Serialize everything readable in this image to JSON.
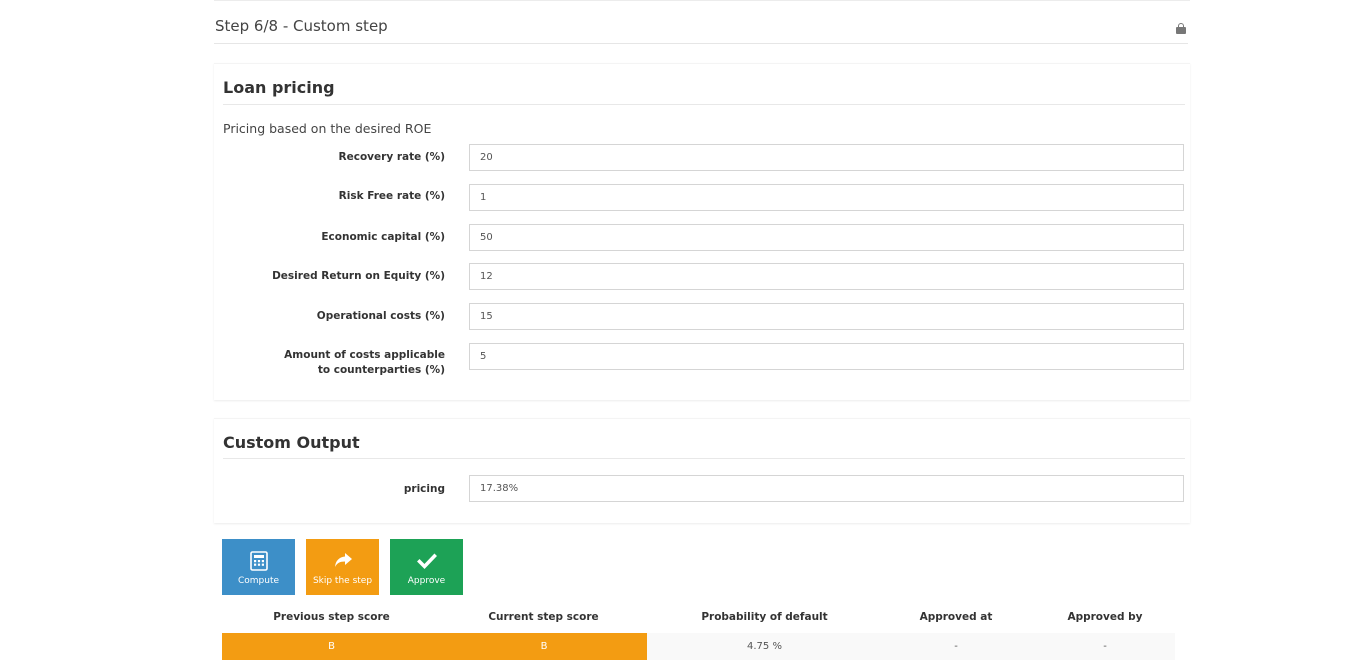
{
  "step": {
    "title": "Step 6/8 - Custom step",
    "lock_icon": "lock-icon"
  },
  "loan_pricing": {
    "title": "Loan pricing",
    "subtitle": "Pricing based on the desired ROE",
    "fields": [
      {
        "label": "Recovery rate (%)",
        "value": "20"
      },
      {
        "label": "Risk Free rate (%)",
        "value": "1"
      },
      {
        "label": "Economic capital (%)",
        "value": "50"
      },
      {
        "label": "Desired Return on Equity (%)",
        "value": "12"
      },
      {
        "label": "Operational costs (%)",
        "value": "15"
      },
      {
        "label": "Amount of costs applicable to counterparties (%)",
        "value": "5"
      }
    ]
  },
  "custom_output": {
    "title": "Custom Output",
    "fields": [
      {
        "label": "pricing",
        "value": "17.38%"
      }
    ]
  },
  "actions": {
    "compute": {
      "label": "Compute",
      "icon": "calculator-icon",
      "color": "#3d8fc8"
    },
    "skip": {
      "label": "Skip the step",
      "icon": "share-arrow-icon",
      "color": "#f39c12"
    },
    "approve": {
      "label": "Approve",
      "icon": "check-icon",
      "color": "#1da256"
    }
  },
  "scores": {
    "headers": [
      "Previous step score",
      "Current step score",
      "Probability of default",
      "Approved at",
      "Approved by"
    ],
    "row": [
      "B",
      "B",
      "4.75 %",
      "-",
      "-"
    ],
    "score_color": "#f39c12"
  }
}
